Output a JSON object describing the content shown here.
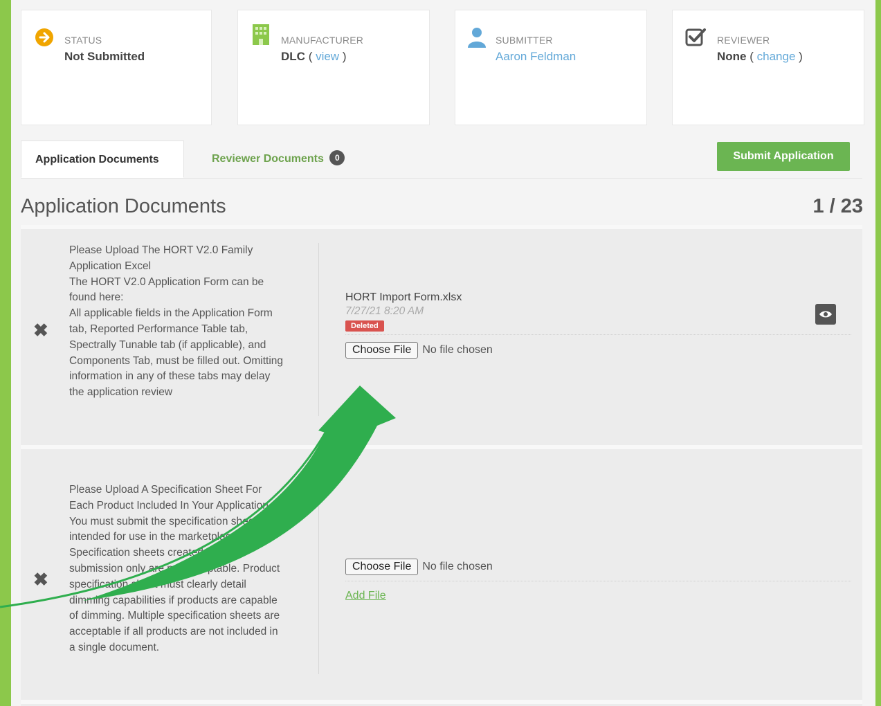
{
  "cards": {
    "status": {
      "label": "STATUS",
      "value": "Not Submitted",
      "icon": "arrow-circle-right-icon",
      "icon_color": "#f0a500"
    },
    "manufacturer": {
      "label": "MANUFACTURER",
      "value": "DLC",
      "paren_open": "( ",
      "link": "view",
      "paren_close": " )",
      "icon": "building-icon",
      "icon_color": "#8cc84b"
    },
    "submitter": {
      "label": "SUBMITTER",
      "link": "Aaron Feldman",
      "icon": "user-icon",
      "icon_color": "#62a8d8"
    },
    "reviewer": {
      "label": "REVIEWER",
      "value": "None",
      "paren_open": "( ",
      "link": "change",
      "paren_close": " )",
      "icon": "checkbox-checked-icon"
    }
  },
  "tabs": {
    "active": "Application Documents",
    "inactive": "Reviewer Documents",
    "reviewer_count": "0"
  },
  "submit_label": "Submit Application",
  "section": {
    "title": "Application Documents",
    "count": "1 / 23"
  },
  "documents": [
    {
      "lines": [
        "Please Upload The HORT V2.0 Family",
        "Application Excel",
        "The HORT V2.0 Application Form can be",
        "found here:",
        "All applicable fields in the Application Form",
        "tab, Reported Performance Table tab,",
        "Spectrally Tunable tab (if applicable), and",
        "Components Tab, must be filled out. Omitting",
        "information in any of these tabs may delay",
        "the application review"
      ],
      "file_name": "HORT Import Form.xlsx",
      "file_date": "7/27/21 8:20 AM",
      "status_badge": "Deleted",
      "choose_label": "Choose File",
      "no_file": "No file chosen"
    },
    {
      "lines": [
        "Please Upload A Specification Sheet For",
        "Each Product Included In Your Application",
        "You must submit the specification sheet",
        "intended for use in the marketplace.",
        "Specification sheets created for DLC",
        "submission only are not acceptable. Product",
        "specification sheet must clearly detail",
        "dimming capabilities if products are capable",
        "of dimming. Multiple specification sheets are",
        "acceptable if all products are not included in",
        "a single document."
      ],
      "choose_label": "Choose File",
      "no_file": "No file chosen",
      "add_file": "Add File"
    }
  ],
  "colors": {
    "brand_green": "#8cc84b",
    "button_green": "#6bb552",
    "arrow_green": "#2fae4e",
    "deleted_red": "#d9534f"
  }
}
